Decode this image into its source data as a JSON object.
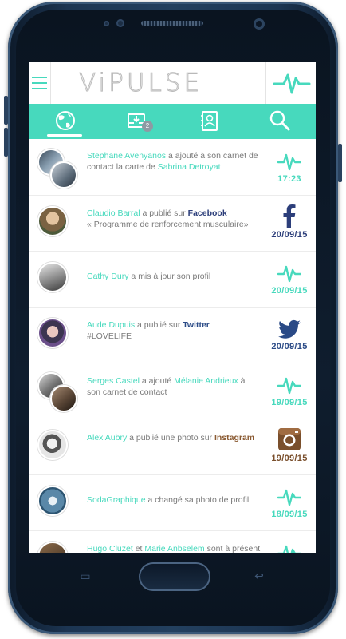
{
  "app": {
    "logo_text": "ViPULSE",
    "accent": "#47d9bd"
  },
  "tabs": [
    {
      "icon": "globe-icon",
      "active": true
    },
    {
      "icon": "inbox-icon",
      "badge": "2"
    },
    {
      "icon": "contacts-book-icon"
    },
    {
      "icon": "search-icon"
    }
  ],
  "feed": [
    {
      "actor": "Stephane Avenyanos",
      "action": " a ajouté à son carnet de contact la carte de ",
      "target": "Sabrina Detroyat",
      "icon": "pulse-icon",
      "time": "17:23",
      "time_color": "#47d9bd"
    },
    {
      "actor": "Claudio Barral",
      "action": " a publié sur ",
      "network": "Facebook",
      "network_color": "#2c3e7a",
      "quote": "« Programme de renforcement musculaire»",
      "icon": "facebook-icon",
      "time": "20/09/15",
      "time_color": "#2c3e7a"
    },
    {
      "actor": "Cathy Dury",
      "action": " a mis à jour son profil",
      "icon": "pulse-icon",
      "time": "20/09/15",
      "time_color": "#47d9bd"
    },
    {
      "actor": "Aude Dupuis",
      "action": " a publié sur ",
      "network": "Twitter",
      "network_color": "#2a4a86",
      "quote": "#LOVELIFE",
      "icon": "twitter-icon",
      "time": "20/09/15",
      "time_color": "#2a4a86"
    },
    {
      "actor": "Serges Castel",
      "action": " a ajouté ",
      "target": "Mélanie Andrieux",
      "action2": " à son carnet de contact",
      "icon": "pulse-icon",
      "time": "19/09/15",
      "time_color": "#47d9bd"
    },
    {
      "actor": "Alex Aubry",
      "action": " a publié une photo sur ",
      "network": "Instagram",
      "network_color": "#8a5a32",
      "icon": "instagram-icon",
      "time": "19/09/15",
      "time_color": "#7a4f2c"
    },
    {
      "actor": "SodaGraphique",
      "action": " a changé sa photo de profil",
      "icon": "pulse-icon",
      "time": "18/09/15",
      "time_color": "#47d9bd"
    },
    {
      "actor": "Hugo Cluzet",
      "action": " et ",
      "target": "Marie Anbselem",
      "action2": " sont à présent",
      "icon": "pulse-icon",
      "time": "",
      "time_color": "#47d9bd"
    }
  ]
}
